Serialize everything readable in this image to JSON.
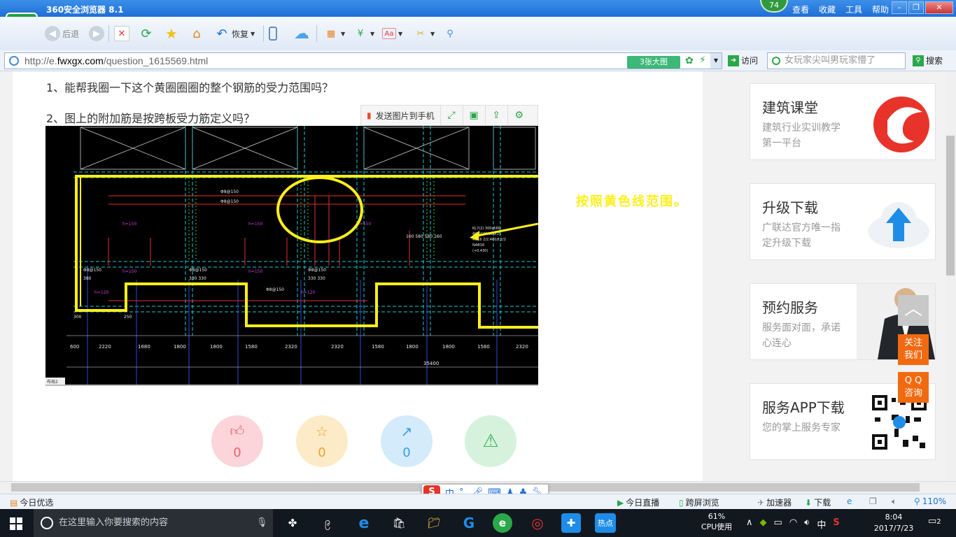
{
  "browser": {
    "title": "360安全浏览器 8.1",
    "score": "74",
    "menu": [
      "查看",
      "收藏",
      "工具",
      "帮助"
    ],
    "logo_letter": "e",
    "nav": {
      "back": "后退",
      "restore": "恢复"
    },
    "address": {
      "prefix": "http://e.",
      "domain": "fwxgx.com",
      "path": "/question_1615569.html"
    },
    "big_image_btn": "3张大图",
    "visit": "访问",
    "search_placeholder": "女玩家尖叫男玩家懵了",
    "search_btn": "搜索"
  },
  "page": {
    "question1": "1、能帮我圈一下这个黄圈圈圈的整个钢筋的受力范围吗？",
    "question2": "2、图上的附加筋是按跨板受力筋定义吗？",
    "image_tools": {
      "send_to_phone": "发送图片到手机"
    },
    "annotation": "按照黄色线范围。",
    "drawing": {
      "bar_labels": [
        "Φ8@150",
        "Φ8@150",
        "Φ8@150",
        "Φ8@150",
        "Φ8@150",
        "Φ8@150",
        "Φ8@150",
        "Φ8@150",
        "Φ8@150"
      ],
      "dims_bottom": [
        "600",
        "2220",
        "1680",
        "1800",
        "1800",
        "1580",
        "2320",
        "2320",
        "1580",
        "1800",
        "1800",
        "1580",
        "2320"
      ],
      "total": "35400",
      "tab": "布局2"
    },
    "actions": [
      {
        "name": "like",
        "count": "0",
        "color": "#fbd5d9",
        "fg": "#e8616f"
      },
      {
        "name": "favorite",
        "count": "0",
        "color": "#fdebc8",
        "fg": "#f0a030"
      },
      {
        "name": "share",
        "count": "0",
        "color": "#d3ebfb",
        "fg": "#3a9ee0"
      },
      {
        "name": "report",
        "count": "",
        "color": "#d6f2dc",
        "fg": "#3bb55a"
      }
    ]
  },
  "sidebar": {
    "cards": [
      {
        "title": "建筑课堂",
        "desc": "建筑行业实训教学第一平台"
      },
      {
        "title": "升级下载",
        "desc": "广联达官方唯一指定升级下载"
      },
      {
        "title": "预约服务",
        "desc": "服务面对面，承诺心连心"
      },
      {
        "title": "服务APP下载",
        "desc": "您的掌上服务专家"
      }
    ],
    "follow": "关注\n我们",
    "qq": "Q Q\n咨询"
  },
  "status": {
    "today_pick": "今日优选",
    "live": "今日直播",
    "cross": "跨屏浏览",
    "accelerator": "加速器",
    "download": "下载",
    "zoom": "110%"
  },
  "ime": {
    "lang": "中"
  },
  "taskbar": {
    "search_placeholder": "在这里输入你要搜索的内容",
    "cpu_pct": "61%",
    "cpu_label": "CPU使用",
    "lang": "中",
    "time": "8:04",
    "date": "2017/7/23",
    "notif": "2",
    "hot": "热点"
  },
  "colors": {
    "brand_green": "#1ea04b",
    "accent_orange": "#f26a10",
    "cad_yellow": "#ffef1a"
  }
}
